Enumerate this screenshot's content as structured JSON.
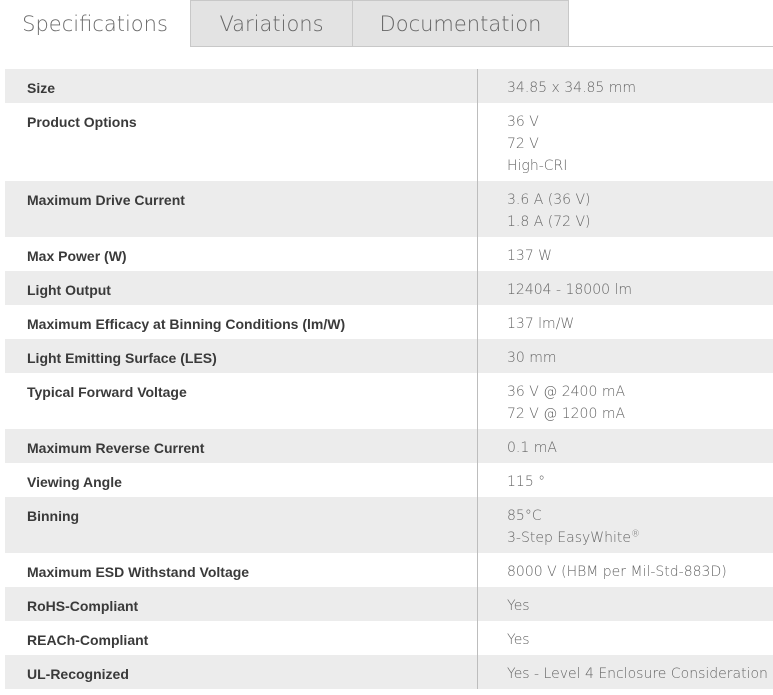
{
  "tabs": [
    {
      "label": "Specifications",
      "active": true
    },
    {
      "label": "Variations",
      "active": false
    },
    {
      "label": "Documentation",
      "active": false
    }
  ],
  "specs": [
    {
      "label": "Size",
      "values": [
        "34.85 x 34.85 mm"
      ]
    },
    {
      "label": "Product Options",
      "values": [
        "36 V",
        "72 V",
        "High-CRI"
      ]
    },
    {
      "label": "Maximum Drive Current",
      "values": [
        "3.6 A (36 V)",
        "1.8 A (72 V)"
      ]
    },
    {
      "label": "Max Power (W)",
      "values": [
        "137 W"
      ]
    },
    {
      "label": "Light Output",
      "values": [
        "12404 - 18000 lm"
      ]
    },
    {
      "label": "Maximum Efficacy at Binning Conditions (lm/W)",
      "values": [
        "137 lm/W"
      ]
    },
    {
      "label": "Light Emitting Surface (LES)",
      "values": [
        "30 mm"
      ]
    },
    {
      "label": "Typical Forward Voltage",
      "values": [
        "36 V @ 2400 mA",
        "72 V @ 1200 mA"
      ]
    },
    {
      "label": "Maximum Reverse Current",
      "values": [
        "0.1 mA"
      ]
    },
    {
      "label": "Viewing Angle",
      "values": [
        "115 °"
      ]
    },
    {
      "label": "Binning",
      "values": [
        "85°C",
        "3-Step EasyWhite"
      ],
      "sup": "®"
    },
    {
      "label": "Maximum ESD Withstand Voltage",
      "values": [
        "8000 V (HBM per Mil-Std-883D)"
      ]
    },
    {
      "label": "RoHS-Compliant",
      "values": [
        "Yes"
      ]
    },
    {
      "label": "REACh-Compliant",
      "values": [
        "Yes"
      ]
    },
    {
      "label": "UL-Recognized",
      "values": [
        "Yes - Level 4 Enclosure Consideration"
      ]
    }
  ]
}
